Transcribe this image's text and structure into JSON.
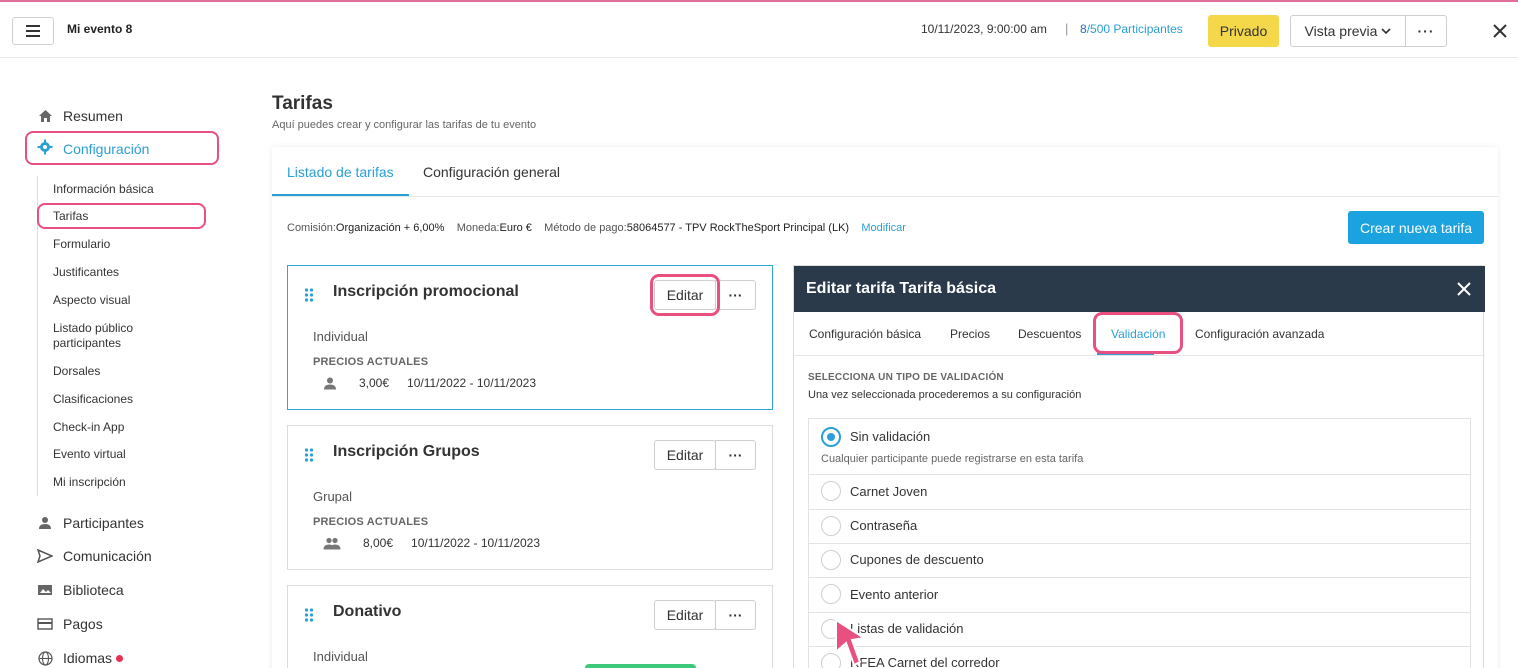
{
  "header": {
    "event_title": "Mi evento 8",
    "date": "10/11/2023, 9:00:00 am",
    "separator": "|",
    "count_current": "8",
    "count_rest": "/500 Participantes",
    "private_label": "Privado",
    "preview_label": "Vista previa",
    "more_label": "···"
  },
  "sidebar": {
    "resumen": "Resumen",
    "configuracion": "Configuración",
    "sub_items": [
      "Información básica",
      "Tarifas",
      "Formulario",
      "Justificantes",
      "Aspecto visual",
      "Listado público participantes",
      "Dorsales",
      "Clasificaciones",
      "Check-in App",
      "Evento virtual",
      "Mi inscripción"
    ],
    "bottom_items": [
      "Participantes",
      "Comunicación",
      "Biblioteca",
      "Pagos",
      "Idiomas"
    ]
  },
  "main": {
    "title": "Tarifas",
    "subtitle": "Aquí puedes crear y configurar las tarifas de tu evento",
    "tabs": [
      "Listado de tarifas",
      "Configuración general"
    ],
    "info": {
      "commission_label": "Comisión:",
      "commission_value": "Organización + 6,00%",
      "currency_label": "Moneda:",
      "currency_value": "Euro €",
      "payment_label": "Método de pago:",
      "payment_value": "58064577 - TPV RockTheSport Principal (LK)",
      "modify_link": "Modificar"
    },
    "new_button": "Crear nueva tarifa",
    "cards": [
      {
        "title": "Inscripción promocional",
        "edit": "Editar",
        "more": "···",
        "type": "Individual",
        "prices_label": "PRECIOS ACTUALES",
        "price": "3,00€",
        "dates": "10/11/2022 - 10/11/2023"
      },
      {
        "title": "Inscripción Grupos",
        "edit": "Editar",
        "more": "···",
        "type": "Grupal",
        "prices_label": "PRECIOS ACTUALES",
        "price": "8,00€",
        "dates": "10/11/2022 - 10/11/2023"
      },
      {
        "title": "Donativo",
        "edit": "Editar",
        "more": "···",
        "type": "Individual"
      }
    ]
  },
  "edit_panel": {
    "title": "Editar tarifa Tarifa básica",
    "tabs": [
      "Configuración básica",
      "Precios",
      "Descuentos",
      "Validación",
      "Configuración avanzada"
    ],
    "active_tab": "Validación",
    "section_title": "SELECCIONA UN TIPO DE VALIDACIÓN",
    "section_sub": "Una vez seleccionada procederemos a su configuración",
    "options": [
      "Sin validación",
      "Carnet Joven",
      "Contraseña",
      "Cupones de descuento",
      "Evento anterior",
      "Listas de validación",
      "RFEA Carnet del corredor"
    ],
    "selected_option": "Sin validación",
    "selected_help": "Cualquier participante puede registrarse en esta tarifa"
  },
  "colors": {
    "accent": "#2a9fd8",
    "highlight": "#e8517f",
    "private_button": "#f5d74a",
    "panel_header": "#2b3a4a",
    "primary_button": "#1aa3de"
  }
}
